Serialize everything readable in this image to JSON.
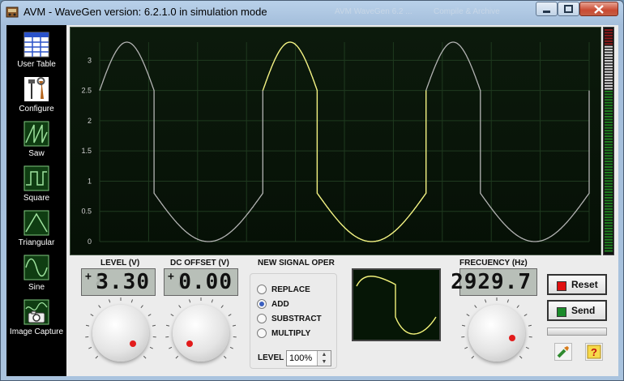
{
  "window": {
    "title": "AVM - WaveGen version: 6.2.1.0 in simulation mode",
    "ghost_title_1": "AVM WaveGen 6.2 ...",
    "ghost_title_2": "Compile & Archive"
  },
  "toolbar": {
    "items": [
      {
        "label": "User Table",
        "icon": "table-icon"
      },
      {
        "label": "Configure",
        "icon": "tools-icon"
      },
      {
        "label": "Saw",
        "icon": "saw-wave-icon"
      },
      {
        "label": "Square",
        "icon": "square-wave-icon"
      },
      {
        "label": "Triangular",
        "icon": "triangle-wave-icon"
      },
      {
        "label": "Sine",
        "icon": "sine-wave-icon"
      },
      {
        "label": "Image Capture",
        "icon": "camera-icon"
      }
    ]
  },
  "chart_data": {
    "type": "line",
    "title": "",
    "xlabel": "",
    "ylabel": "",
    "ylim": [
      0,
      3.3
    ],
    "yticks": [
      "0",
      "0.5",
      "1",
      "1.5",
      "2",
      "2.5",
      "3"
    ],
    "grid": true,
    "series": [
      {
        "color": "#b3b3b3",
        "values": [
          2.5,
          3.3,
          2.5,
          0.8,
          0,
          0.8,
          2.5,
          3.3,
          2.5,
          0.8,
          0,
          0.8,
          2.5,
          3.3,
          2.5,
          0.8,
          0,
          0.8
        ]
      },
      {
        "color": "#f2f27a",
        "values": [
          2.5,
          3.3,
          2.5,
          0.8,
          0,
          0.8
        ]
      }
    ]
  },
  "level": {
    "caption": "LEVEL (V)",
    "sign": "+",
    "value": "3.30"
  },
  "dc_offset": {
    "caption": "DC OFFSET (V)",
    "sign": "+",
    "value": "0.00"
  },
  "operation": {
    "caption": "NEW SIGNAL OPER",
    "options": [
      "REPLACE",
      "ADD",
      "SUBSTRACT",
      "MULTIPLY"
    ],
    "selected": "ADD",
    "level_label": "LEVEL",
    "level_value": "100%"
  },
  "frequency": {
    "caption": "FRECUENCY (Hz)",
    "value": "2929.7"
  },
  "buttons": {
    "reset": "Reset",
    "send": "Send",
    "reset_color": "#e01010",
    "send_color": "#1a8a2a"
  },
  "help_icon": "?"
}
